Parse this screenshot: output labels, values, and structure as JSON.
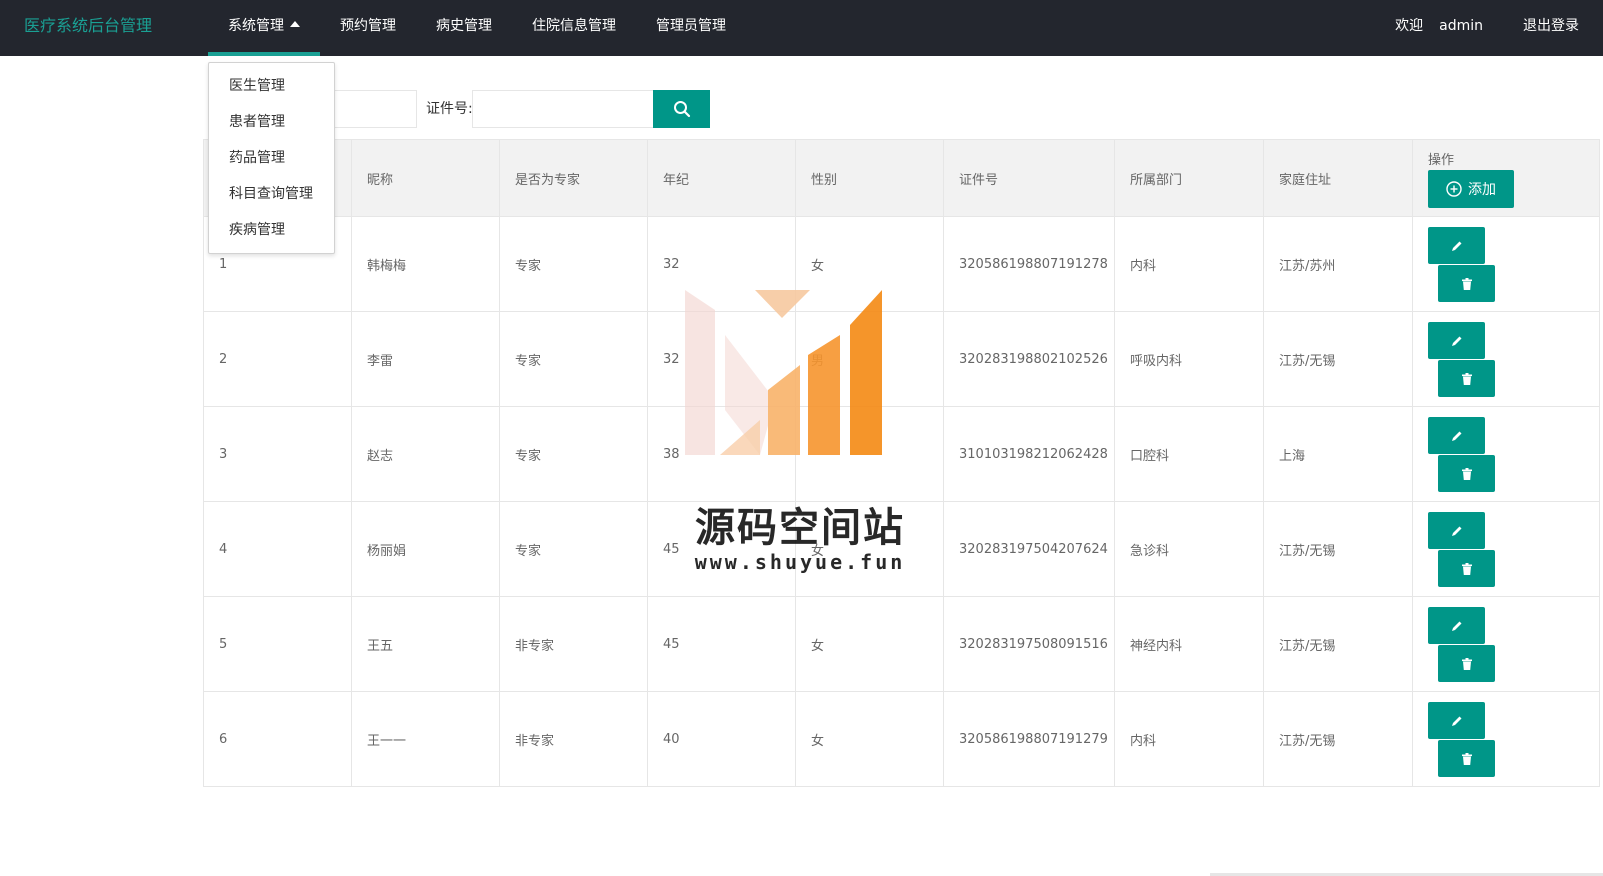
{
  "app": {
    "title": "医疗系统后台管理"
  },
  "nav": {
    "items": [
      {
        "label": "系统管理",
        "active": true
      },
      {
        "label": "预约管理"
      },
      {
        "label": "病史管理"
      },
      {
        "label": "住院信息管理"
      },
      {
        "label": "管理员管理"
      }
    ]
  },
  "user": {
    "welcome": "欢迎",
    "name": "admin",
    "logout": "退出登录"
  },
  "dropdown": {
    "items": [
      "医生管理",
      "患者管理",
      "药品管理",
      "科目查询管理",
      "疾病管理"
    ]
  },
  "search": {
    "id_label": "证件号:",
    "id_value": "",
    "icon": "search-icon"
  },
  "table": {
    "headers": [
      "",
      "昵称",
      "是否为专家",
      "年纪",
      "性别",
      "证件号",
      "所属部门",
      "家庭住址",
      "操作"
    ],
    "add_label": "添加",
    "rows": [
      [
        "1",
        "韩梅梅",
        "专家",
        "32",
        "女",
        "320586198807191278",
        "内科",
        "江苏/苏州"
      ],
      [
        "2",
        "李雷",
        "专家",
        "32",
        "男",
        "320283198802102526",
        "呼吸内科",
        "江苏/无锡"
      ],
      [
        "3",
        "赵志",
        "专家",
        "38",
        "",
        "310103198212062428",
        "口腔科",
        "上海"
      ],
      [
        "4",
        "杨丽娟",
        "专家",
        "45",
        "女",
        "320283197504207624",
        "急诊科",
        "江苏/无锡"
      ],
      [
        "5",
        "王五",
        "非专家",
        "45",
        "女",
        "320283197508091516",
        "神经内科",
        "江苏/无锡"
      ],
      [
        "6",
        "王一一",
        "非专家",
        "40",
        "女",
        "320586198807191279",
        "内科",
        "江苏/无锡"
      ]
    ]
  },
  "watermark": {
    "title": "源码空间站",
    "url": "www.shuyue.fun"
  },
  "colors": {
    "accent": "#009688",
    "topbar": "#23262e",
    "logo": "#1aa094"
  }
}
